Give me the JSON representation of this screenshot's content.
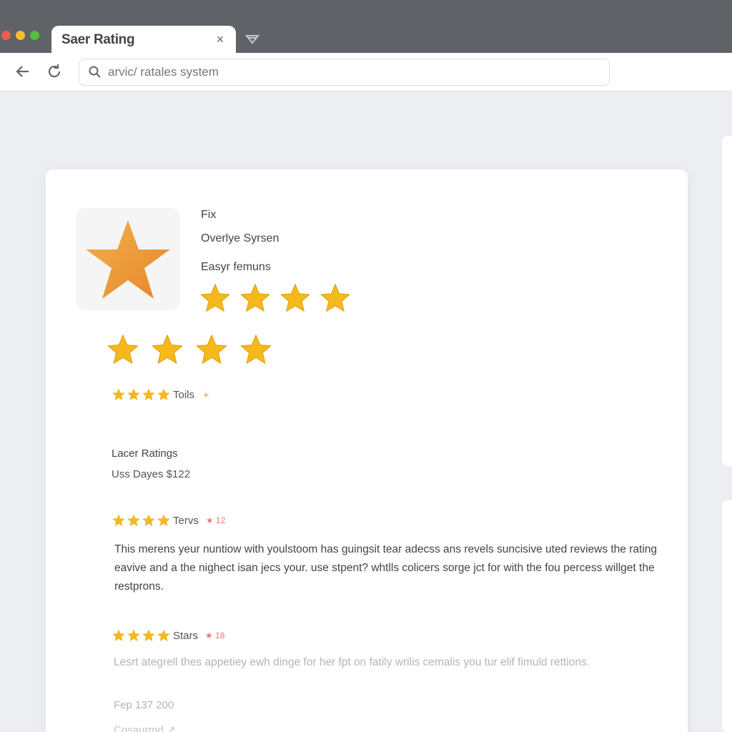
{
  "browser": {
    "tab_title": "Saer Rating",
    "tab_close": "×",
    "address_text": "arvic/ ratales system"
  },
  "product": {
    "logo_icon": "star-logo-icon",
    "meta_line_1": "Fix",
    "meta_line_2": "Overlye Syrsen",
    "meta_line_3": "Easyr femuns",
    "stars_row_1": 4,
    "stars_row_2": 4
  },
  "summary_row": {
    "stars": 4,
    "label": "Toils",
    "plus": "+"
  },
  "section": {
    "title": "Lacer Ratings",
    "subtitle": "Uss Dayes $122"
  },
  "reviews": [
    {
      "stars": 4,
      "label": "Tervs",
      "count": "★ 12",
      "text": "This merens yeur nuntiow with youlstoom has guingsit tear adecss ans revels suncisive uted reviews the rating eavive and a the nighect isan jecs your. use stpent? whtlls colicers sorge jct for with the fou percess willget the restprons."
    },
    {
      "stars": 4,
      "label": "Stars",
      "count": "★ 18",
      "text": "Lesrt ategrell thes appetiey ewh dinge for her fpt on fatily wrilis cemalis you tur elif fimuld rettions.",
      "date": "Fep 137 200",
      "more": "Cosaurrnd ↗"
    }
  ],
  "colors": {
    "star": "#f5b91c",
    "logo_star": "#ec9a3c",
    "chrome_dark": "#5f6368",
    "accent_plus": "#e8944a"
  }
}
